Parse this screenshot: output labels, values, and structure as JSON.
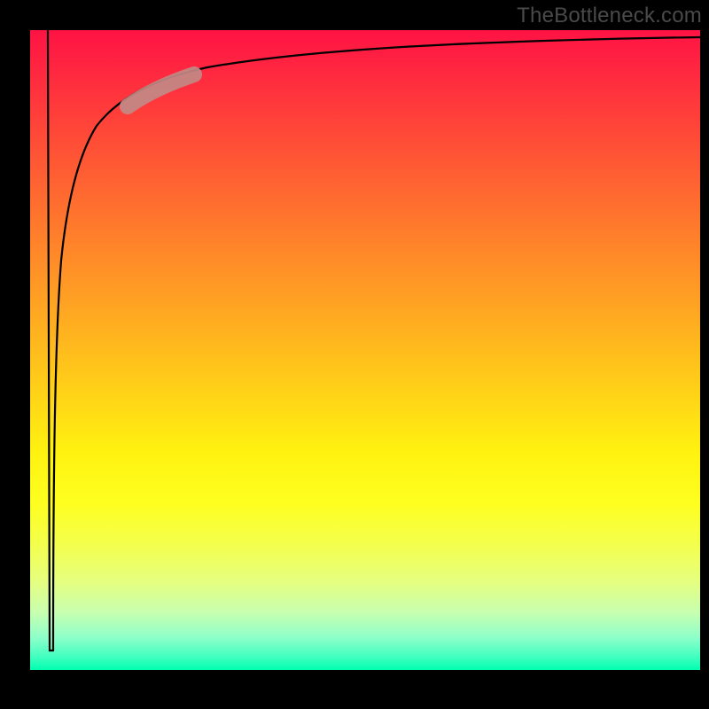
{
  "watermark": "TheBottleneck.com",
  "colors": {
    "frame": "#000000",
    "curve": "#000000",
    "highlight": "#c28a85",
    "watermark": "#4a4a4a"
  },
  "chart_data": {
    "type": "line",
    "title": "",
    "xlabel": "",
    "ylabel": "",
    "xlim": [
      0,
      100
    ],
    "ylim": [
      0,
      100
    ],
    "grid": false,
    "legend": false,
    "annotations": [
      {
        "kind": "highlight-segment",
        "x_range": [
          15,
          22
        ],
        "note": "thick pink band on curve"
      }
    ],
    "series": [
      {
        "name": "spike-down",
        "x": [
          2.6,
          3.0,
          3.4
        ],
        "values": [
          100,
          3,
          100
        ],
        "note": "narrow vertical dip from top to near-bottom and back"
      },
      {
        "name": "log-like-curve",
        "x": [
          3.4,
          4,
          5,
          6,
          8,
          10,
          12,
          15,
          18,
          22,
          28,
          35,
          45,
          60,
          80,
          100
        ],
        "values": [
          3,
          30,
          50,
          60,
          70,
          77,
          81,
          85,
          88,
          90,
          92,
          93.5,
          95,
          96,
          97,
          97.5
        ],
        "note": "sharply rising then flattening curve; y is percent of plot height from bottom"
      }
    ]
  }
}
